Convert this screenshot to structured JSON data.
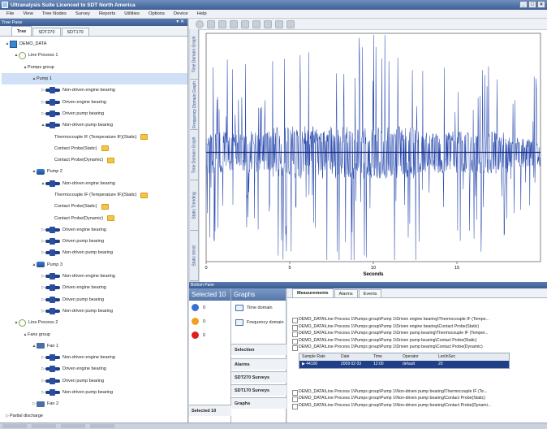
{
  "window": {
    "title": "Ultranalysis Suite Licenced to SDT North America"
  },
  "menu": [
    "File",
    "View",
    "Tree Nodes",
    "Survey",
    "Reports",
    "Utilities",
    "Options",
    "Device",
    "Help"
  ],
  "left_pane": {
    "header": "Tree Pane",
    "tabs": [
      "Tree",
      "SDT270",
      "SDT170"
    ],
    "tree": [
      {
        "label": "DEMO_DATA",
        "level": 0,
        "icon": "database-icon",
        "arrow": "▲"
      },
      {
        "label": "Line Process 1",
        "level": 1,
        "icon": "process-icon",
        "arrow": "▲"
      },
      {
        "label": "Pumps group",
        "level": 2,
        "icon": "",
        "arrow": "▲"
      },
      {
        "label": "Pump 1",
        "level": 3,
        "icon": "",
        "arrow": "▲",
        "selected": true
      },
      {
        "label": "Non-driven engine bearing",
        "level": 4,
        "icon": "bearing-icon",
        "arrow": "▷"
      },
      {
        "label": "Driven engine bearing",
        "level": 4,
        "icon": "bearing-icon",
        "arrow": "▷"
      },
      {
        "label": "Driven pump bearing",
        "level": 4,
        "icon": "bearing-icon",
        "arrow": "▷"
      },
      {
        "label": "Non-driven pump bearing",
        "level": 4,
        "icon": "bearing-icon",
        "arrow": "▲"
      },
      {
        "label": "Thermocouple IF (Temperature IF)(Static)",
        "level": 5,
        "icon": "",
        "arrow": "",
        "folder": true
      },
      {
        "label": "Contact Probe(Static)",
        "level": 5,
        "icon": "",
        "arrow": "",
        "folder": true
      },
      {
        "label": "Contact Probe(Dynamic)",
        "level": 5,
        "icon": "",
        "arrow": "",
        "folder": true
      },
      {
        "label": "Pump 2",
        "level": 3,
        "icon": "pump-icon",
        "arrow": "▲"
      },
      {
        "label": "Non-driven engine bearing",
        "level": 4,
        "icon": "bearing-icon",
        "arrow": "▲"
      },
      {
        "label": "Thermocouple IF (Temperature IF)(Static)",
        "level": 5,
        "icon": "",
        "arrow": "",
        "folder": true
      },
      {
        "label": "Contact Probe(Static)",
        "level": 5,
        "icon": "",
        "arrow": "",
        "folder": true
      },
      {
        "label": "Contact Probe(Dynamic)",
        "level": 5,
        "icon": "",
        "arrow": "",
        "folder": true
      },
      {
        "label": "Driven engine bearing",
        "level": 4,
        "icon": "bearing-icon",
        "arrow": "▷"
      },
      {
        "label": "Driven pump bearing",
        "level": 4,
        "icon": "bearing-icon",
        "arrow": "▷"
      },
      {
        "label": "Non-driven pump bearing",
        "level": 4,
        "icon": "bearing-icon",
        "arrow": "▷"
      },
      {
        "label": "Pump 3",
        "level": 3,
        "icon": "pump-icon",
        "arrow": "▲"
      },
      {
        "label": "Non-driven engine bearing",
        "level": 4,
        "icon": "bearing-icon",
        "arrow": "▷"
      },
      {
        "label": "Driven engine bearing",
        "level": 4,
        "icon": "bearing-icon",
        "arrow": "▷"
      },
      {
        "label": "Driven pump bearing",
        "level": 4,
        "icon": "bearing-icon",
        "arrow": "▷"
      },
      {
        "label": "Non-driven pump bearing",
        "level": 4,
        "icon": "bearing-icon",
        "arrow": "▷"
      },
      {
        "label": "Line Process 2",
        "level": 1,
        "icon": "process-icon",
        "arrow": "▲"
      },
      {
        "label": "Fans group",
        "level": 2,
        "icon": "",
        "arrow": "▲"
      },
      {
        "label": "Fan 1",
        "level": 3,
        "icon": "fan-icon",
        "arrow": "▲"
      },
      {
        "label": "Non-driven engine bearing",
        "level": 4,
        "icon": "bearing-icon",
        "arrow": "▷"
      },
      {
        "label": "Driven engine bearing",
        "level": 4,
        "icon": "bearing-icon",
        "arrow": "▷"
      },
      {
        "label": "Driven pump bearing",
        "level": 4,
        "icon": "bearing-icon",
        "arrow": "▷"
      },
      {
        "label": "Non-driven pump bearing",
        "level": 4,
        "icon": "bearing-icon",
        "arrow": "▷"
      },
      {
        "label": "Fan 2",
        "level": 3,
        "icon": "fan-icon",
        "arrow": "▷"
      },
      {
        "label": "Partial discharge",
        "level": 0,
        "icon": "",
        "arrow": "▷"
      }
    ]
  },
  "vertical_tabs": [
    "Time Domain Graph",
    "Frequency Domain Graph",
    "Time Domain Graph",
    "Static Trending",
    "Static trend"
  ],
  "chart_data": {
    "type": "line",
    "xlabel": "Seconds",
    "xticks": [
      0,
      5,
      10,
      15
    ],
    "xlim": [
      0,
      20
    ],
    "grid": false,
    "series_color": "#2f4fb0"
  },
  "bottom_pane": {
    "header": "Bottom Pane",
    "selected_header": "Selected 10",
    "selected_items": [
      {
        "count": "0",
        "color": "#3b6fd0"
      },
      {
        "count": "0",
        "color": "#f0a020"
      },
      {
        "count": "0",
        "color": "#e02020"
      }
    ],
    "selected_footer": "Selected 10",
    "graphs_header": "Graphs",
    "graph_items": [
      "Time domain",
      "Frequency domain"
    ],
    "nav_buttons": [
      "Selection",
      "Alarms",
      "SDT270 Surveys",
      "SDT170 Surveys",
      "Graphs"
    ]
  },
  "measurements": {
    "tabs": [
      "Measurements",
      "Alarms",
      "Events"
    ],
    "rows_top": [
      "DEMO_DATA\\Line Process 1\\Pumps group\\Pump 1\\Driven engine bearing\\Thermocouple IF (Tempe...",
      "DEMO_DATA\\Line Process 1\\Pumps group\\Pump 1\\Driven engine bearing\\Contact Probe(Static)",
      "DEMO_DATA\\Line Process 1\\Pumps group\\Pump 1\\Driven pump bearing\\Thermocouple IF (Temper...",
      "DEMO_DATA\\Line Process 1\\Pumps group\\Pump 1\\Driven pump bearing\\Contact Probe(Static)",
      "DEMO_DATA\\Line Process 1\\Pumps group\\Pump 1\\Driven pump bearing\\Contact Probe(Dynamic)"
    ],
    "sub_columns": [
      "Sample Rate",
      "Date",
      "Time",
      "Operator",
      "LenInSec"
    ],
    "sub_row": [
      "44100",
      "2009 02 03",
      "12:00",
      "default",
      "20"
    ],
    "rows_bottom": [
      "DEMO_DATA\\Line Process 1\\Pumps group\\Pump 1\\Non-driven pump bearing\\Thermocouple IF (Te...",
      "DEMO_DATA\\Line Process 1\\Pumps group\\Pump 1\\Non-driven pump bearing\\Contact Probe(Static)",
      "DEMO_DATA\\Line Process 1\\Pumps group\\Pump 1\\Non-driven pump bearing\\Contact Probe(Dynami..."
    ]
  }
}
